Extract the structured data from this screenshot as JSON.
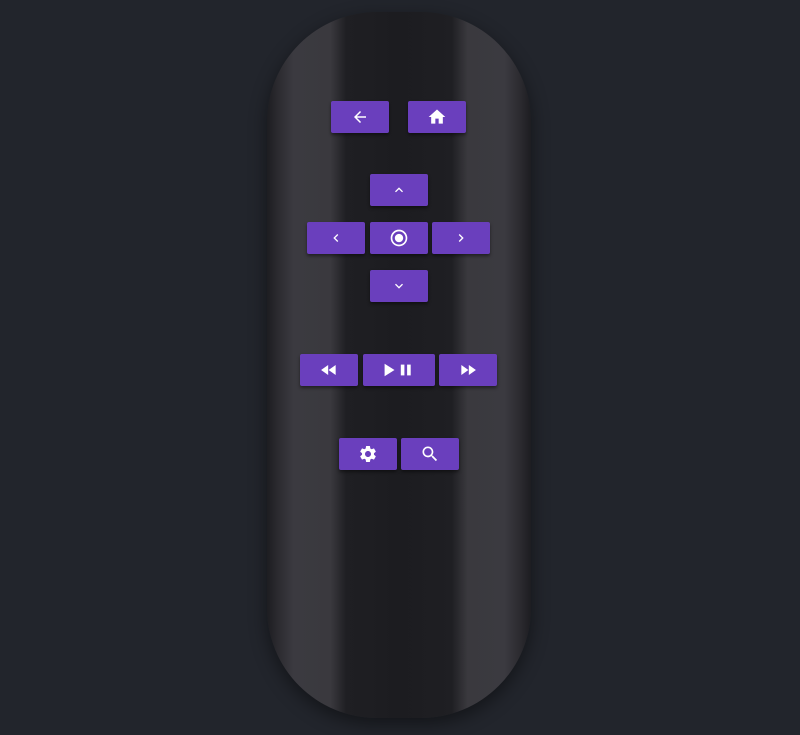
{
  "remote": {
    "colors": {
      "background": "#22252c",
      "body": "#1c1c20",
      "button": "#6a3fbd",
      "icon": "#ffffff"
    },
    "buttons": [
      {
        "name": "back-button",
        "icon": "arrow-left-icon"
      },
      {
        "name": "home-button",
        "icon": "home-icon"
      },
      {
        "name": "up-button",
        "icon": "chevron-up-icon"
      },
      {
        "name": "left-button",
        "icon": "chevron-left-icon"
      },
      {
        "name": "ok-button",
        "icon": "radio-button-checked-icon"
      },
      {
        "name": "right-button",
        "icon": "chevron-right-icon"
      },
      {
        "name": "down-button",
        "icon": "chevron-down-icon"
      },
      {
        "name": "rewind-button",
        "icon": "fast-rewind-icon"
      },
      {
        "name": "play-pause-button",
        "icon": "play-pause-icon"
      },
      {
        "name": "fast-forward-button",
        "icon": "fast-forward-icon"
      },
      {
        "name": "settings-button",
        "icon": "gear-icon"
      },
      {
        "name": "search-button",
        "icon": "search-icon"
      }
    ]
  }
}
